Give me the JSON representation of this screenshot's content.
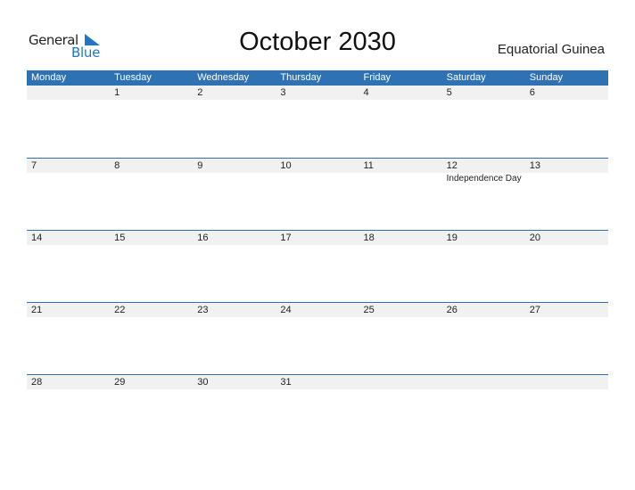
{
  "logo": {
    "general": "General",
    "blue": "Blue",
    "accent": "#1f77c7"
  },
  "title": "October 2030",
  "country": "Equatorial Guinea",
  "colors": {
    "header_bg": "#2e72b4",
    "row_bg": "#f1f1f1"
  },
  "weekdays": [
    "Monday",
    "Tuesday",
    "Wednesday",
    "Thursday",
    "Friday",
    "Saturday",
    "Sunday"
  ],
  "weeks": [
    {
      "days": [
        "",
        "1",
        "2",
        "3",
        "4",
        "5",
        "6"
      ],
      "events": [
        "",
        "",
        "",
        "",
        "",
        "",
        ""
      ]
    },
    {
      "days": [
        "7",
        "8",
        "9",
        "10",
        "11",
        "12",
        "13"
      ],
      "events": [
        "",
        "",
        "",
        "",
        "",
        "Independence Day",
        ""
      ]
    },
    {
      "days": [
        "14",
        "15",
        "16",
        "17",
        "18",
        "19",
        "20"
      ],
      "events": [
        "",
        "",
        "",
        "",
        "",
        "",
        ""
      ]
    },
    {
      "days": [
        "21",
        "22",
        "23",
        "24",
        "25",
        "26",
        "27"
      ],
      "events": [
        "",
        "",
        "",
        "",
        "",
        "",
        ""
      ]
    },
    {
      "days": [
        "28",
        "29",
        "30",
        "31",
        "",
        "",
        ""
      ],
      "events": [
        "",
        "",
        "",
        "",
        "",
        "",
        ""
      ]
    }
  ]
}
